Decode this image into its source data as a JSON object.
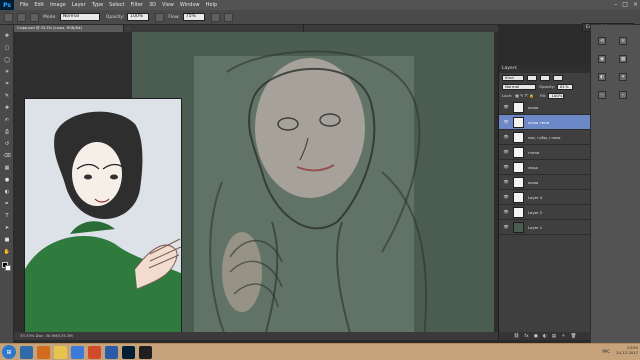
{
  "app": {
    "name": "Photoshop",
    "menu_items": [
      "File",
      "Edit",
      "Image",
      "Layer",
      "Type",
      "Select",
      "Filter",
      "3D",
      "View",
      "Window",
      "Help"
    ]
  },
  "options_bar": {
    "mode_label": "Mode:",
    "mode_value": "Normal",
    "opacity_label": "Opacity:",
    "opacity_value": "100%",
    "flow_label": "Flow:",
    "flow_value": "75%",
    "workspace": "Essentials"
  },
  "tabs": [
    {
      "label": "Софи.psd @ 33.3% (кожа, RGB/8#)"
    },
    {
      "label": "…"
    }
  ],
  "status_bar": {
    "text": "33.33%   Doc: 30.9M/135.3M"
  },
  "layers_panel": {
    "tab_title": "Layers",
    "kind_label": "Kind",
    "blend_mode": "Normal",
    "opacity_label": "Opacity:",
    "opacity_value": "61%",
    "lock_label": "Lock:",
    "fill_label": "Fill:",
    "fill_value": "100%",
    "layers": [
      {
        "name": "кожа",
        "selected": false
      },
      {
        "name": "кожа тени",
        "selected": true
      },
      {
        "name": "нос, губы, глаза",
        "selected": false
      },
      {
        "name": "глаза",
        "selected": false
      },
      {
        "name": "лицо",
        "selected": false
      },
      {
        "name": "кожа",
        "selected": false
      },
      {
        "name": "Layer 4",
        "selected": false
      },
      {
        "name": "Layer 2",
        "selected": false
      },
      {
        "name": "Layer 1",
        "selected": false
      }
    ]
  },
  "taskbar": {
    "language": "РУС",
    "time": "23:55",
    "date": "24.12.2017"
  },
  "colors": {
    "app_bg": "#2b2b2b",
    "panel": "#4a4a4a",
    "selected_layer": "#6d88c6",
    "canvas_green": "#4b5d50"
  }
}
